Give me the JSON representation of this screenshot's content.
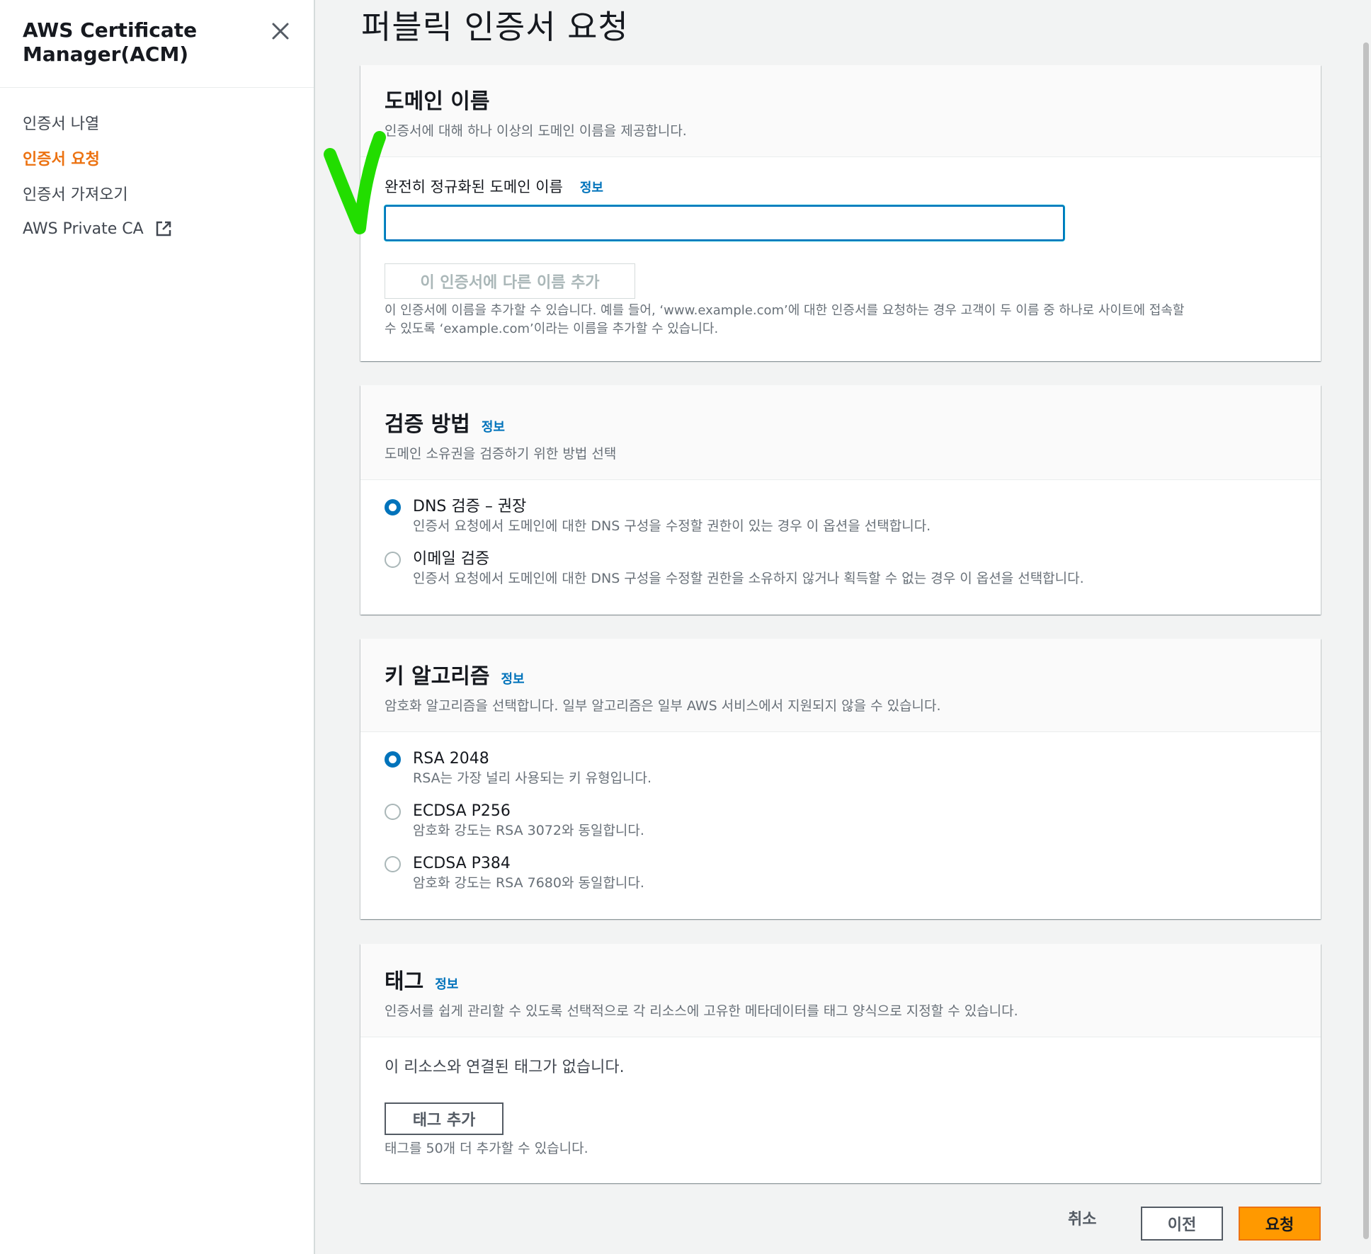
{
  "sidebar": {
    "title": "AWS Certificate Manager(ACM)",
    "items": [
      {
        "label": "인증서 나열"
      },
      {
        "label": "인증서 요청"
      },
      {
        "label": "인증서 가져오기"
      },
      {
        "label": "AWS Private CA"
      }
    ]
  },
  "page": {
    "title": "퍼블릭 인증서 요청"
  },
  "domain": {
    "title": "도메인 이름",
    "desc": "인증서에 대해 하나 이상의 도메인 이름을 제공합니다.",
    "field_label": "완전히 정규화된 도메인 이름",
    "info": "정보",
    "input_value": "",
    "add_button": "이 인증서에 다른 이름 추가",
    "help_line1": "이 인증서에 이름을 추가할 수 있습니다. 예를 들어, ‘www.example.com’에 대한 인증서를 요청하는 경우 고객이 두 이름 중 하나로 사이트에 접속할",
    "help_line2": "수 있도록 ‘example.com’이라는 이름을 추가할 수 있습니다."
  },
  "validation": {
    "title": "검증 방법",
    "info": "정보",
    "desc": "도메인 소유권을 검증하기 위한 방법 선택",
    "options": [
      {
        "label": "DNS 검증 – 권장",
        "desc": "인증서 요청에서 도메인에 대한 DNS 구성을 수정할 권한이 있는 경우 이 옵션을 선택합니다.",
        "checked": true
      },
      {
        "label": "이메일 검증",
        "desc": "인증서 요청에서 도메인에 대한 DNS 구성을 수정할 권한을 소유하지 않거나 획득할 수 없는 경우 이 옵션을 선택합니다.",
        "checked": false
      }
    ]
  },
  "key_algorithm": {
    "title": "키 알고리즘",
    "info": "정보",
    "desc": "암호화 알고리즘을 선택합니다. 일부 알고리즘은 일부 AWS 서비스에서 지원되지 않을 수 있습니다.",
    "options": [
      {
        "label": "RSA 2048",
        "desc": "RSA는 가장 널리 사용되는 키 유형입니다.",
        "checked": true
      },
      {
        "label": "ECDSA P256",
        "desc": "암호화 강도는 RSA 3072와 동일합니다.",
        "checked": false
      },
      {
        "label": "ECDSA P384",
        "desc": "암호화 강도는 RSA 7680와 동일합니다.",
        "checked": false
      }
    ]
  },
  "tags": {
    "title": "태그",
    "info": "정보",
    "desc": "인증서를 쉽게 관리할 수 있도록 선택적으로 각 리소스에 고유한 메타데이터를 태그 양식으로 지정할 수 있습니다.",
    "empty": "이 리소스와 연결된 태그가 없습니다.",
    "add_button": "태그 추가",
    "help": "태그를 50개 더 추가할 수 있습니다."
  },
  "footer": {
    "cancel": "취소",
    "previous": "이전",
    "submit": "요청"
  },
  "colors": {
    "accent": "#ec7211",
    "primary": "#ff9900",
    "link": "#0073bb",
    "annotation": "#22dd00"
  }
}
